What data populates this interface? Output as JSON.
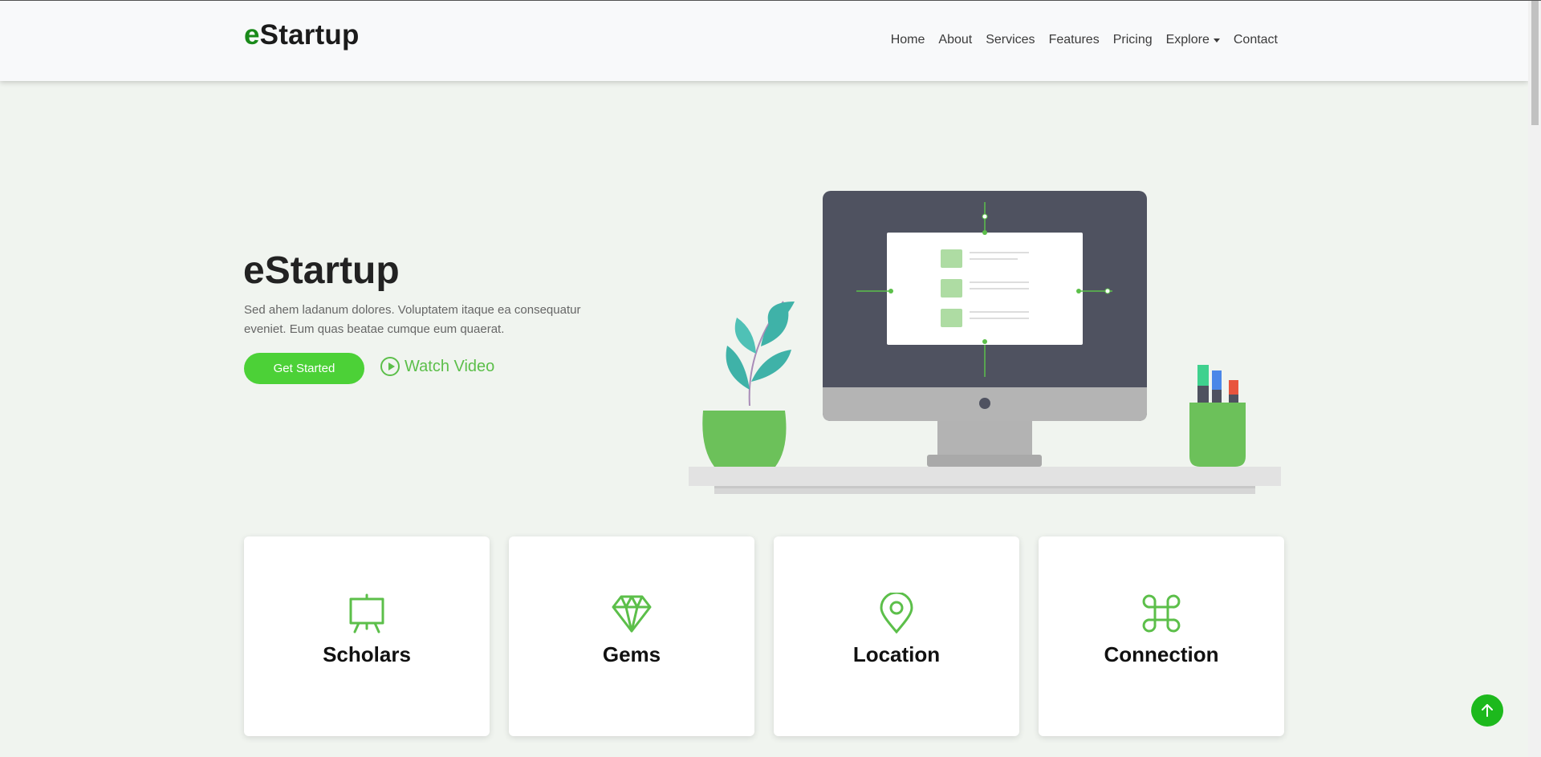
{
  "brand": {
    "logo_first": "e",
    "logo_rest": "Startup",
    "accent": "#1a8a1a"
  },
  "nav": {
    "items": [
      {
        "label": "Home"
      },
      {
        "label": "About"
      },
      {
        "label": "Services"
      },
      {
        "label": "Features"
      },
      {
        "label": "Pricing"
      },
      {
        "label": "Explore",
        "dropdown": true
      },
      {
        "label": "Contact"
      }
    ]
  },
  "hero": {
    "title": "eStartup",
    "text": "Sed ahem ladanum dolores. Voluptatem itaque ea consequatur eveniet. Eum quas beatae cumque eum quaerat.",
    "cta_label": "Get Started",
    "video_label": "Watch Video",
    "cta_color": "#4cd137"
  },
  "features": [
    {
      "title": "Scholars",
      "icon": "easel-icon"
    },
    {
      "title": "Gems",
      "icon": "diamond-icon"
    },
    {
      "title": "Location",
      "icon": "location-pin-icon"
    },
    {
      "title": "Connection",
      "icon": "command-icon"
    }
  ],
  "colors": {
    "icon_green": "#5cbf4a",
    "to_top": "#1db91d",
    "page_bg": "#f0f4ef"
  }
}
